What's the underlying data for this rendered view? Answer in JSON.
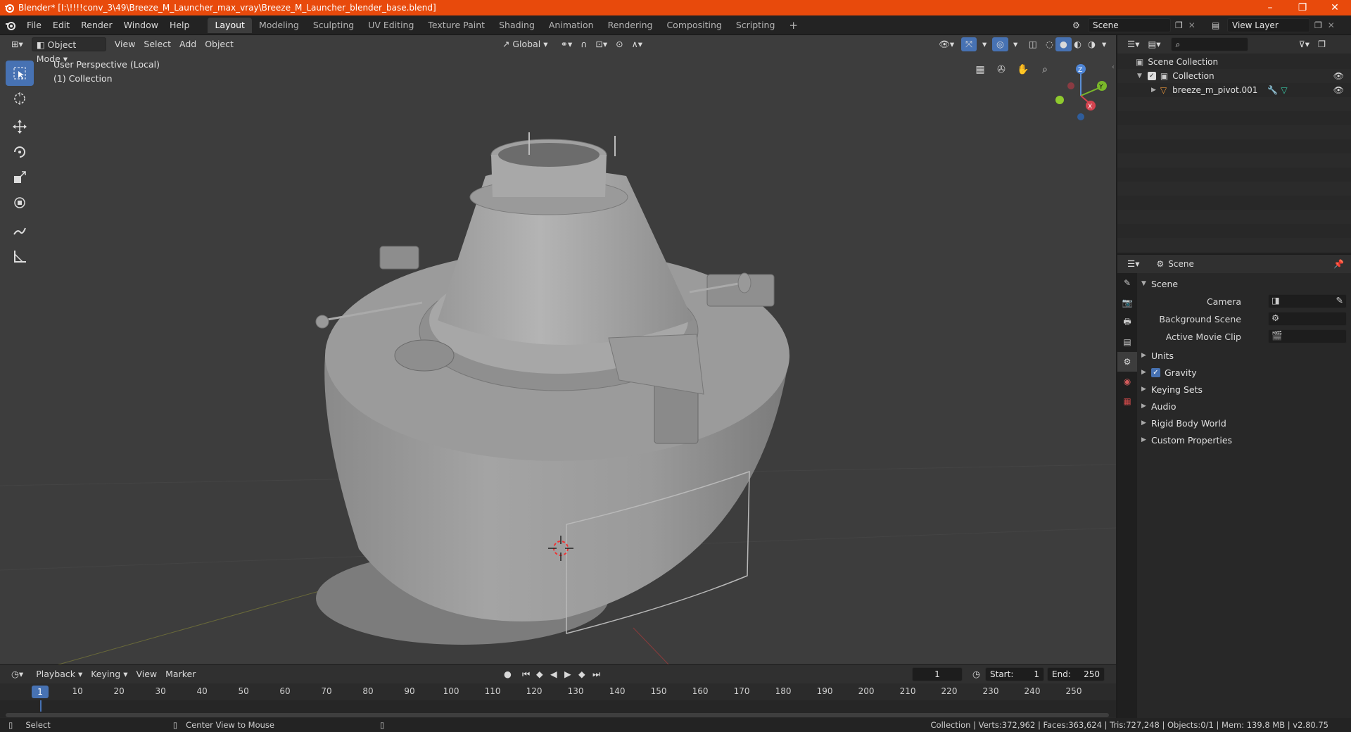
{
  "window": {
    "title": "Blender* [I:\\!!!!conv_3\\49\\Breeze_M_Launcher_max_vray\\Breeze_M_Launcher_blender_base.blend]",
    "minimize": "–",
    "maximize": "❐",
    "close": "✕"
  },
  "menu": [
    "File",
    "Edit",
    "Render",
    "Window",
    "Help"
  ],
  "workspaces": [
    "Layout",
    "Modeling",
    "Sculpting",
    "UV Editing",
    "Texture Paint",
    "Shading",
    "Animation",
    "Rendering",
    "Compositing",
    "Scripting"
  ],
  "workspace_add": "+",
  "scene_selector": {
    "value": "Scene"
  },
  "view_layer": {
    "value": "View Layer"
  },
  "viewport": {
    "mode": "Object Mode",
    "menus": [
      "View",
      "Select",
      "Add",
      "Object"
    ],
    "orientation": "Global",
    "info_line1": "User Perspective (Local)",
    "info_line2": "(1) Collection",
    "gizmo": {
      "x": "X",
      "y": "Y",
      "z": "Z"
    }
  },
  "timeline": {
    "menus": [
      "Playback",
      "Keying",
      "View",
      "Marker"
    ],
    "current_frame": "1",
    "start_label": "Start:",
    "start": "1",
    "end_label": "End:",
    "end": "250",
    "ticks": [
      "10",
      "20",
      "30",
      "40",
      "50",
      "60",
      "70",
      "80",
      "90",
      "100",
      "110",
      "120",
      "130",
      "140",
      "150",
      "160",
      "170",
      "180",
      "190",
      "200",
      "210",
      "220",
      "230",
      "240",
      "250"
    ],
    "playhead": "1"
  },
  "statusbar": {
    "select": "Select",
    "center_view": "Center View to Mouse",
    "stats": "Collection | Verts:372,962 | Faces:363,624 | Tris:727,248 | Objects:0/1 | Mem: 139.8 MB | v2.80.75"
  },
  "outliner": {
    "scene_collection": "Scene Collection",
    "collection": "Collection",
    "object": "breeze_m_pivot.001"
  },
  "properties": {
    "context": "Scene",
    "panel": "Scene",
    "camera_label": "Camera",
    "background_scene_label": "Background Scene",
    "active_movie_clip_label": "Active Movie Clip",
    "sections": [
      "Units",
      "Gravity",
      "Keying Sets",
      "Audio",
      "Rigid Body World",
      "Custom Properties"
    ]
  },
  "colors": {
    "titlebar": "#e84a0c",
    "accent": "#4772b3",
    "viewport_bg": "#3d3d3d"
  }
}
